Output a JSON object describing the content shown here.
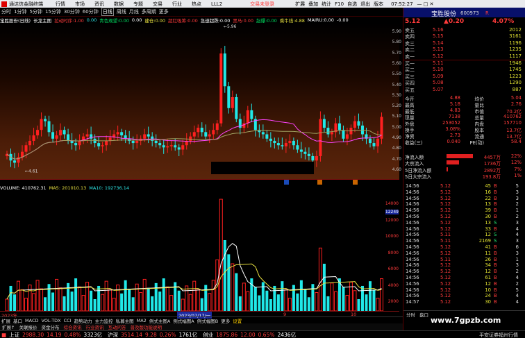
{
  "titlebar": {
    "app": "通达信金融终端",
    "menus": [
      "行情",
      "市场",
      "资讯",
      "数据",
      "专题",
      "交易",
      "行业",
      "热点",
      "LLL2"
    ],
    "trade_note": "交易未登录",
    "buttons": [
      "扩展",
      "叠加",
      "统计",
      "F10",
      "自选",
      "退出",
      "版本"
    ],
    "time": "07:52:27"
  },
  "periods": [
    "分时",
    "1分钟",
    "5分钟",
    "15分钟",
    "30分钟",
    "60分钟",
    "日线",
    "周线",
    "月线",
    "多周期",
    "更多"
  ],
  "active_period": "日线",
  "indicator_line": [
    {
      "t": "宝胜股份(日线)",
      "c": "wht"
    },
    {
      "t": "长龙主图",
      "c": "wht"
    },
    {
      "t": "拉动时序:1.00",
      "c": "red"
    },
    {
      "t": "0.00",
      "c": "cyn"
    },
    {
      "t": "青色观望:0.00",
      "c": "grn"
    },
    {
      "t": "0.00",
      "c": "wht"
    },
    {
      "t": "建仓:0.00",
      "c": "yel"
    },
    {
      "t": "超红吸筹:0.00",
      "c": "red"
    },
    {
      "t": "急速超跌:0.00",
      "c": "wht"
    },
    {
      "t": "黑马:0.00",
      "c": "red"
    },
    {
      "t": "起爆:0.00",
      "c": "grn"
    },
    {
      "t": "乘牛线:4.88",
      "c": "yel"
    },
    {
      "t": "MAIRU:0.00",
      "c": "wht"
    },
    {
      "t": "-0.00",
      "c": "wht"
    }
  ],
  "kaxis": [
    "5.90",
    "5.80",
    "5.70",
    "5.60",
    "5.50",
    "5.40",
    "5.30",
    "5.20",
    "5.10",
    "5.00",
    "4.90",
    "4.80",
    "4.70",
    "4.60"
  ],
  "kmarks": {
    "high": "5.96",
    "low": "4.61"
  },
  "volheader": [
    {
      "t": "VOLUME: 410762.31",
      "c": "wht"
    },
    {
      "t": "MA5: 201010.13",
      "c": "yel"
    },
    {
      "t": "MA10: 192736.14",
      "c": "cyn"
    }
  ],
  "volaxis": [
    "14000",
    "12000",
    "10000",
    "8000",
    "6000",
    "4000",
    "2000"
  ],
  "volmark": "12249",
  "xaxis": {
    "left": "2023年",
    "date": "2023/07/17/一",
    "right": "日线"
  },
  "quote": {
    "name": "宝胜股份",
    "code": "600973",
    "price": "5.12",
    "change": "▲0.20",
    "pct": "4.07%",
    "sell": [
      {
        "l": "卖五",
        "p": "5.16",
        "v": "2012"
      },
      {
        "l": "卖四",
        "p": "5.15",
        "v": "3161"
      },
      {
        "l": "卖三",
        "p": "5.14",
        "v": "1196"
      },
      {
        "l": "卖二",
        "p": "5.13",
        "v": "1235"
      },
      {
        "l": "卖一",
        "p": "5.12",
        "v": "1117"
      }
    ],
    "buy": [
      {
        "l": "买一",
        "p": "5.11",
        "v": "1946"
      },
      {
        "l": "买二",
        "p": "5.10",
        "v": "1745"
      },
      {
        "l": "买三",
        "p": "5.09",
        "v": "1223"
      },
      {
        "l": "买四",
        "p": "5.08",
        "v": "1290"
      },
      {
        "l": "买五",
        "p": "5.07",
        "v": "887"
      }
    ],
    "stats": [
      [
        "今开",
        "4.88",
        "均价",
        "5.04"
      ],
      [
        "最高",
        "5.18",
        "量比",
        "2.76"
      ],
      [
        "最低",
        "4.83",
        "市值",
        "70.2亿"
      ],
      [
        "现量",
        "7138",
        "总量",
        "410762"
      ],
      [
        "外盘",
        "253052",
        "内盘",
        "157710"
      ],
      [
        "换手",
        "3.08%",
        "股本",
        "13.7亿"
      ],
      [
        "净资",
        "2.73",
        "流通",
        "13.7亿"
      ],
      [
        "收益(三)",
        "0.040",
        "PE(动)",
        "58.4"
      ]
    ],
    "flows": [
      {
        "l": "净流入额",
        "v": "4457万",
        "p": "22%"
      },
      {
        "l": "大宗流入",
        "v": "1736万",
        "p": "12%"
      },
      {
        "l": "5日净流入额",
        "v": "2892万",
        "p": "7%"
      },
      {
        "l": "5日大宗流入",
        "v": "193.8万",
        "p": "1%"
      }
    ],
    "ticks": [
      [
        "14:56",
        "5.12",
        "45",
        "B",
        "5"
      ],
      [
        "14:56",
        "5.12",
        "16",
        "B",
        "3"
      ],
      [
        "14:56",
        "5.12",
        "22",
        "B",
        "3"
      ],
      [
        "14:56",
        "5.12",
        "13",
        "B",
        "2"
      ],
      [
        "14:56",
        "5.12",
        "39",
        "B",
        "1"
      ],
      [
        "14:56",
        "5.12",
        "30",
        "B",
        "2"
      ],
      [
        "14:56",
        "5.12",
        "13",
        "S",
        "3"
      ],
      [
        "14:56",
        "5.12",
        "33",
        "B",
        "4"
      ],
      [
        "14:56",
        "5.11",
        "12",
        "S",
        "4"
      ],
      [
        "14:56",
        "5.11",
        "2169",
        "S",
        "3"
      ],
      [
        "14:56",
        "5.12",
        "41",
        "B",
        "6"
      ],
      [
        "14:56",
        "5.12",
        "11",
        "B",
        "3"
      ],
      [
        "14:56",
        "5.11",
        "26",
        "B",
        "1"
      ],
      [
        "14:56",
        "5.12",
        "34",
        "B",
        "3"
      ],
      [
        "14:56",
        "5.12",
        "12",
        "B",
        "2"
      ],
      [
        "14:56",
        "5.12",
        "61",
        "B",
        "4"
      ],
      [
        "14:56",
        "5.12",
        "12",
        "B",
        "2"
      ],
      [
        "14:56",
        "5.12",
        "10",
        "B",
        "5"
      ],
      [
        "14:56",
        "5.12",
        "24",
        "B",
        "4"
      ],
      [
        "14:57",
        "5.12",
        "30",
        "B",
        "4"
      ]
    ],
    "tabs": [
      "分时",
      "盘口"
    ]
  },
  "bottom_tabs": [
    "扩展",
    "基口",
    "MACD",
    "VOL-TDX",
    "CCI",
    "趋势动力",
    "主力监控",
    "私募主图",
    "MA2",
    "例式主图A",
    "例式幅图A",
    "例式幅图B",
    "更多",
    "设置"
  ],
  "bottom_tabs2": [
    "扩展↑",
    "关联报价",
    "资金分布",
    "综合资讯",
    "行业资讯",
    "互动问答",
    "普及版功能说明"
  ],
  "statusbar": {
    "items": [
      {
        "t": "上证",
        "c": "wht"
      },
      {
        "t": "2988.30",
        "c": "red"
      },
      {
        "t": "14.19",
        "c": "red"
      },
      {
        "t": "0.48%",
        "c": "red"
      },
      {
        "t": "3323亿",
        "c": "wht"
      },
      {
        "t": "沪深",
        "c": "wht"
      },
      {
        "t": "3514.14",
        "c": "red"
      },
      {
        "t": "9.28",
        "c": "red"
      },
      {
        "t": "0.26%",
        "c": "red"
      },
      {
        "t": "1761亿",
        "c": "wht"
      },
      {
        "t": "创业",
        "c": "wht"
      },
      {
        "t": "1875.86",
        "c": "red"
      },
      {
        "t": "12.00",
        "c": "red"
      },
      {
        "t": "0.65%",
        "c": "red"
      },
      {
        "t": "2436亿",
        "c": "wht"
      }
    ],
    "right": "平安证券福州行情",
    "watermark": "www.7gpzb.com"
  },
  "chart_data": {
    "type": "candlestick",
    "series": [
      {
        "name": "VOLUME"
      },
      {
        "name": "MA5"
      },
      {
        "name": "MA10"
      }
    ],
    "ylim": [
      4.55,
      5.98
    ],
    "vol_ylim": [
      0,
      15000
    ]
  }
}
